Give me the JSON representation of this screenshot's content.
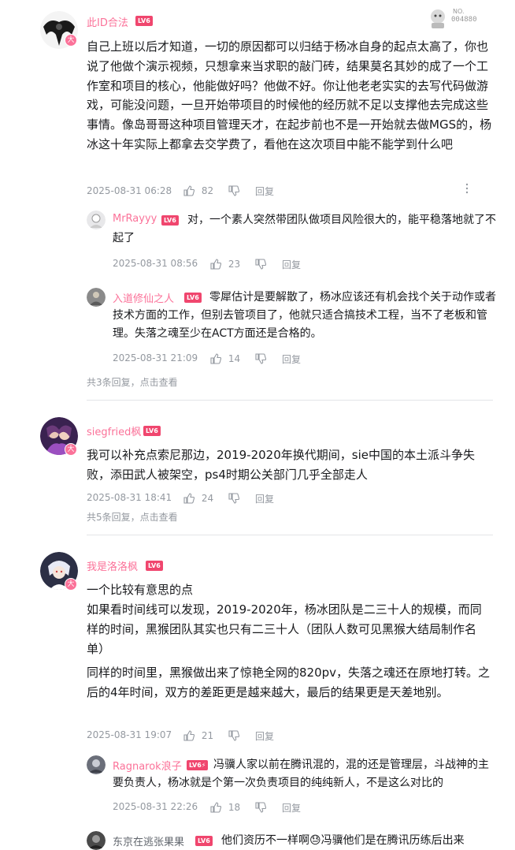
{
  "colors": {
    "accent": "#fb7299",
    "meta": "#9499a0",
    "text": "#18191c"
  },
  "badge_big": "大",
  "comments": [
    {
      "user": "此ID合法",
      "level": "LV6",
      "fan_badge_no": "NO.",
      "fan_badge_num": "004880",
      "text": "自己上班以后才知道，一切的原因都可以归结于杨冰自身的起点太高了，你也说了他做个演示视频，只想拿来当求职的敲门砖，结果莫名其妙的成了一个工作室和项目的核心，他能做好吗？他做不好。你让他老老实实的去写代码做游戏，可能没问题，一旦开始带项目的时候他的经历就不足以支撑他去完成这些事情。像岛哥哥这种项目管理天才，在起步前也不是一开始就去做MGS的，杨冰这十年实际上都拿去交学费了，看他在这次项目中能不能学到什么吧",
      "time": "2025-08-31 06:28",
      "likes": "82",
      "reply_label": "回复",
      "replies": [
        {
          "user": "MrRayyy",
          "level": "LV6",
          "text": "对，一个素人突然带团队做项目风险很大的，能平稳落地就了不起了",
          "time": "2025-08-31 08:56",
          "likes": "23",
          "reply_label": "回复"
        },
        {
          "user": "入道修仙之人",
          "level": "LV6",
          "text": "零犀估计是要解散了，杨冰应该还有机会找个关于动作或者技术方面的工作，但别去管项目了，他就只适合搞技术工程，当不了老板和管理。失落之魂至少在ACT方面还是合格的。",
          "time": "2025-08-31 21:09",
          "likes": "14",
          "reply_label": "回复"
        }
      ],
      "more_replies": "共3条回复，点击查看"
    },
    {
      "user": "siegfried枫",
      "level": "LV6",
      "text": "我可以补充点索尼那边，2019-2020年换代期间，sie中国的本土派斗争失败，添田武人被架空，ps4时期公关部门几乎全部走人",
      "time": "2025-08-31 18:41",
      "likes": "24",
      "reply_label": "回复",
      "more_replies": "共5条回复，点击查看"
    },
    {
      "user": "我是洛洛枫",
      "level": "LV6",
      "text_lines": [
        "一个比较有意思的点",
        "如果看时间线可以发现，2019-2020年，杨冰团队是二三十人的规模，而同样的时间，黑猴团队其实也只有二三十人（团队人数可见黑猴大结局制作名单）",
        "同样的时间里，黑猴做出来了惊艳全网的820pv，失落之魂还在原地打转。之后的4年时间，双方的差距更是越来越大，最后的结果更是天差地别。"
      ],
      "time": "2025-08-31 19:07",
      "likes": "21",
      "reply_label": "回复",
      "replies": [
        {
          "user": "Ragnarok浪子",
          "level": "LV6⚡",
          "text": "冯骥人家以前在腾讯混的，混的还是管理层，斗战神的主要负责人，杨冰就是个第一次负责项目的纯纯新人，不是这么对比的",
          "time": "2025-08-31 22:26",
          "likes": "18",
          "reply_label": "回复"
        },
        {
          "user": "东京在逃张果果",
          "level": "LV6",
          "text": "他们资历不一样啊😓冯骥他们是在腾讯历练后出来",
          "time": "",
          "likes": "",
          "reply_label": ""
        }
      ]
    }
  ]
}
